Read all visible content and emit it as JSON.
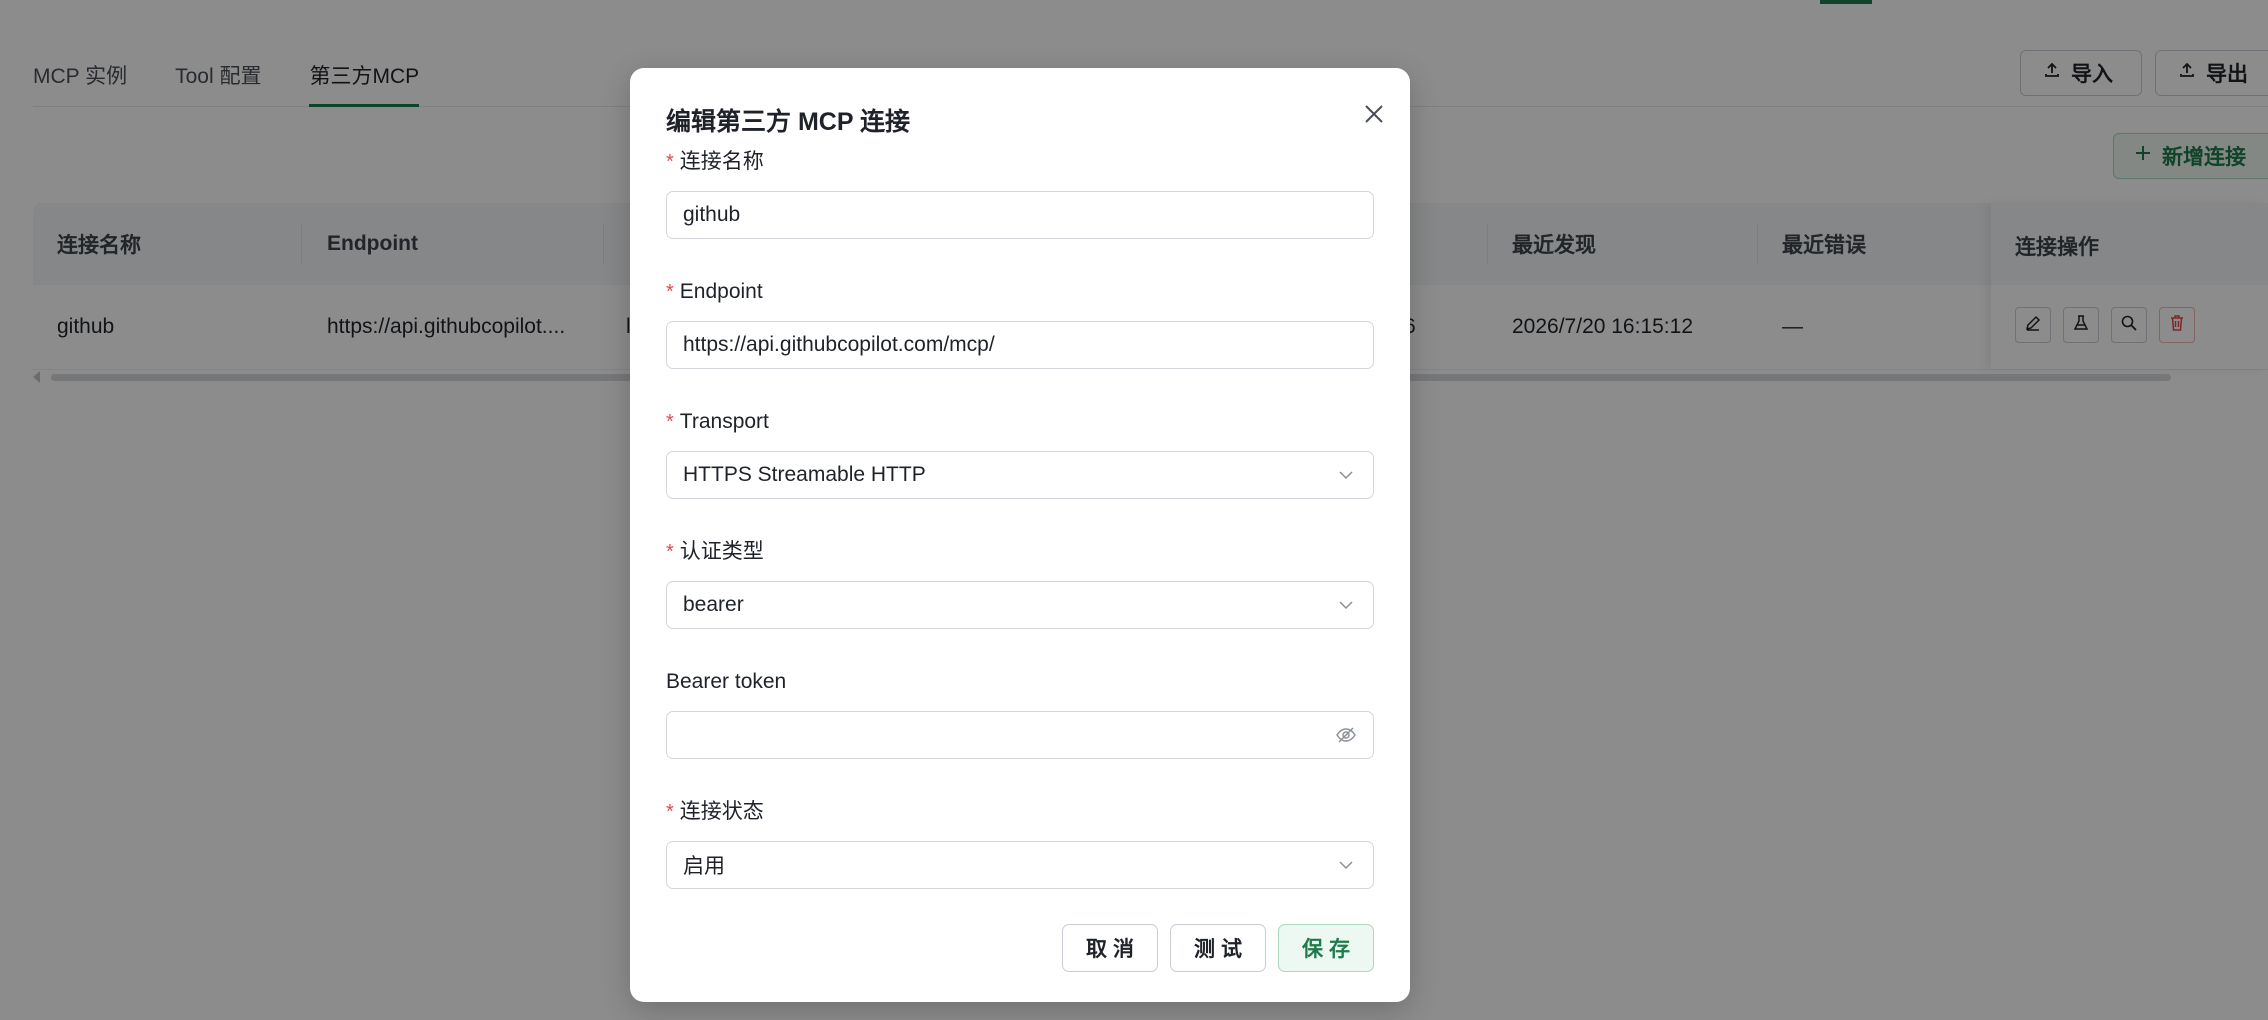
{
  "tabs": [
    {
      "label": "MCP 实例",
      "active": false
    },
    {
      "label": "Tool 配置",
      "active": false
    },
    {
      "label": "第三方MCP",
      "active": true
    }
  ],
  "toolbar": {
    "import_label": "导入",
    "export_label": "导出",
    "add_label": "新增连接"
  },
  "table": {
    "columns": [
      "连接名称",
      "Endpoint",
      "最近发现",
      "最近错误",
      "连接操作"
    ],
    "rows": [
      {
        "name": "github",
        "endpoint": "https://api.githubcopilot....",
        "partial_a": "l",
        "partial_b": "6",
        "last_discovery": "2026/7/20 16:15:12",
        "last_error": "—"
      }
    ]
  },
  "modal": {
    "title": "编辑第三方 MCP 连接",
    "fields": {
      "name": {
        "label": "连接名称",
        "required": true,
        "value": "github"
      },
      "endpoint": {
        "label": "Endpoint",
        "required": true,
        "value": "https://api.githubcopilot.com/mcp/"
      },
      "transport": {
        "label": "Transport",
        "required": true,
        "value": "HTTPS Streamable HTTP"
      },
      "auth_type": {
        "label": "认证类型",
        "required": true,
        "value": "bearer"
      },
      "bearer_token": {
        "label": "Bearer token",
        "required": false,
        "value": ""
      },
      "status": {
        "label": "连接状态",
        "required": true,
        "value": "启用"
      }
    },
    "buttons": {
      "cancel": "取消",
      "test": "测试",
      "save": "保存"
    }
  },
  "colors": {
    "accent": "#1f7a4d",
    "required": "#e5484d",
    "danger": "#e5484d"
  }
}
